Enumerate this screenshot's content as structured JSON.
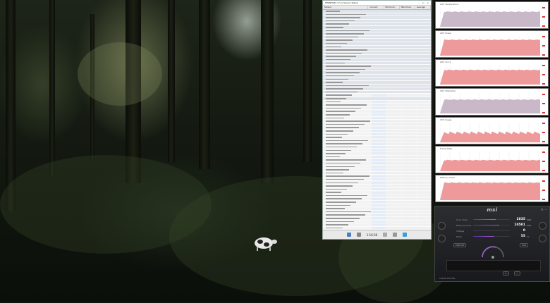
{
  "game": {
    "scene": "jungle"
  },
  "hwinfo": {
    "title_text": "HWiNFO64 v7.xx Sensor Status",
    "columns": [
      "Sensor",
      "Current",
      "Minimum",
      "Maximum",
      "Average"
    ],
    "row_count": 92,
    "footer": {
      "time": "1:16:36"
    },
    "accent": "#e4ecf7"
  },
  "graphs": {
    "panels": [
      {
        "label": "GPU Temperature",
        "color": "#c8b8c8",
        "level": 0.78
      },
      {
        "label": "GPU Power",
        "color": "#ef9a9a",
        "level": 0.82
      },
      {
        "label": "GPU Clock",
        "color": "#ef9a9a",
        "level": 0.76
      },
      {
        "label": "GPU Utilization",
        "color": "#c8b8c8",
        "level": 0.72
      },
      {
        "label": "CPU Usage",
        "color": "#ef9a9a",
        "level": 0.55
      },
      {
        "label": "Frame Rate",
        "color": "#ef9a9a",
        "level": 0.58
      },
      {
        "label": "Memory Used",
        "color": "#ef9a9a",
        "level": 0.9
      }
    ]
  },
  "afterburner": {
    "brand": "msi",
    "sliders": [
      {
        "label": "Core Clock",
        "value": "2835",
        "unit": "MHz",
        "fill": 0.62
      },
      {
        "label": "Memory Clock",
        "value": "10501",
        "unit": "MHz",
        "fill": 0.72
      },
      {
        "label": "Voltage",
        "value": "0",
        "unit": "",
        "fill": 0.0
      },
      {
        "label": "Temp",
        "value": "55",
        "unit": "°C",
        "fill": 0.55
      }
    ],
    "buttons": {
      "profile": "PROFILE",
      "apply": "✓",
      "reset": "↺",
      "fan": "FAN",
      "curve": "CURVE EDITOR"
    },
    "colors": {
      "accent": "#a85ad6"
    }
  }
}
